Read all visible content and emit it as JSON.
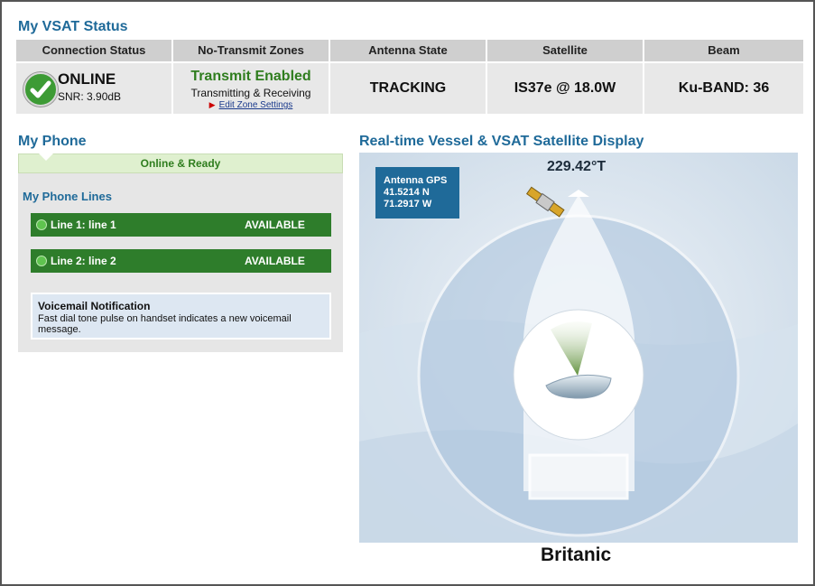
{
  "vsat_status": {
    "title": "My VSAT Status",
    "headers": [
      "Connection Status",
      "No-Transmit Zones",
      "Antenna State",
      "Satellite",
      "Beam"
    ],
    "connection": {
      "state": "ONLINE",
      "snr_label": "SNR:",
      "snr_value": "3.90dB"
    },
    "transmit": {
      "title": "Transmit Enabled",
      "subtitle": "Transmitting & Receiving",
      "link": "Edit Zone Settings"
    },
    "antenna_state": "TRACKING",
    "satellite": "IS37e @ 18.0W",
    "beam": "Ku-BAND: 36"
  },
  "my_phone": {
    "title": "My Phone",
    "ready_status": "Online & Ready",
    "lines_title": "My Phone Lines",
    "lines": [
      {
        "name": "Line 1: line 1",
        "status": "AVAILABLE"
      },
      {
        "name": "Line 2: line 2",
        "status": "AVAILABLE"
      }
    ],
    "voicemail": {
      "title": "Voicemail Notification",
      "text": "Fast dial tone pulse on handset indicates a new voicemail message."
    }
  },
  "display": {
    "title": "Real-time Vessel & VSAT Satellite Display",
    "gps": {
      "label": "Antenna GPS",
      "lat": "41.5214 N",
      "lon": "71.2917 W"
    },
    "heading": "229.42°T",
    "vessel_name": "Britanic"
  },
  "colors": {
    "title_blue": "#1f6a99",
    "online_green": "#3d9b35",
    "line_green": "#2e7d2b",
    "transmit_green": "#2f7d1e"
  }
}
